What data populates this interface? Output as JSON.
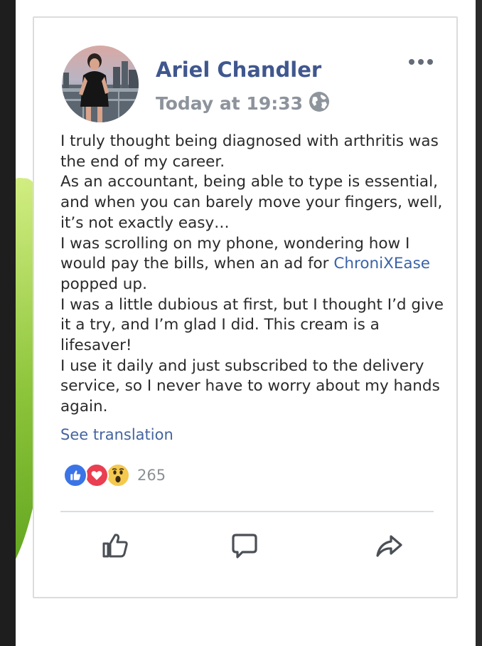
{
  "post": {
    "author": "Ariel Chandler",
    "timestamp": "Today at 19:33",
    "body": {
      "line1": "I truly thought being diagnosed with arthritis was the end of my career.",
      "line2": "As an accountant, being able to type is essential, and when you can barely move your fingers, well, it’s not exactly easy…",
      "line3_before": "I was scrolling on my phone, wondering how I would pay the bills, when an ad for ",
      "brand": "ChroniXEase",
      "line3_after": " popped up.",
      "line4": "I was a little dubious at first, but I thought I’d give it a try, and I’m glad I did. This cream is a lifesaver!",
      "line5": "I use it daily and just subscribed to the delivery service, so I never have to worry about my hands again."
    },
    "see_translation": "See translation",
    "reaction_count": "265"
  },
  "icons": {
    "globe": "globe-icon",
    "more": "more-icon",
    "like_reaction": "like-reaction-icon",
    "love_reaction": "love-reaction-icon",
    "wow_reaction": "wow-reaction-icon",
    "like_action": "thumbs-up-icon",
    "comment_action": "comment-icon",
    "share_action": "share-icon"
  },
  "colors": {
    "author": "#40578e",
    "link": "#45649f",
    "timestamp": "#8d939c",
    "like": "#3b74e6",
    "love": "#ea3e51",
    "wow": "#f5c94e"
  }
}
